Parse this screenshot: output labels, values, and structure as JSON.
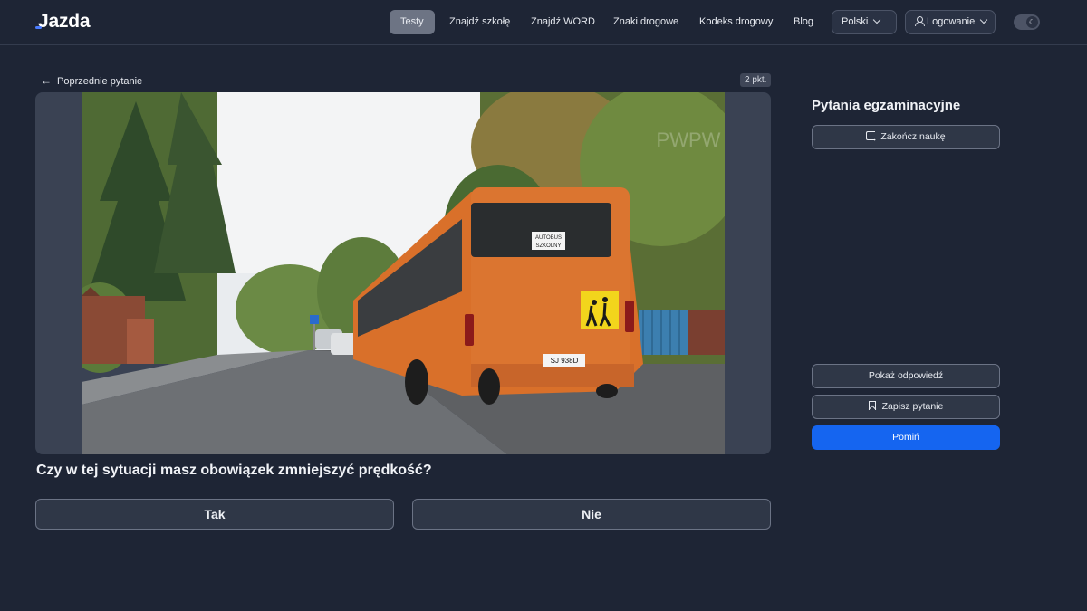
{
  "header": {
    "logo": "Jazda",
    "nav": [
      {
        "label": "Testy",
        "active": true
      },
      {
        "label": "Znajdź szkołę"
      },
      {
        "label": "Znajdź WORD"
      },
      {
        "label": "Znaki drogowe"
      },
      {
        "label": "Kodeks drogowy"
      },
      {
        "label": "Blog"
      }
    ],
    "language": "Polski",
    "login": "Logowanie",
    "theme_toggle_icon": "moon-icon"
  },
  "question_panel": {
    "back_label": "Poprzednie pytanie",
    "points": "2 pkt.",
    "question": "Czy w tej sytuacji masz obowiązek zmniejszyć prędkość?",
    "answers": [
      "Tak",
      "Nie"
    ],
    "photo": {
      "bus_sign": [
        "AUTOBUS",
        "SZKOLNY"
      ],
      "plate": "SJ 938D",
      "watermark": "PWPW"
    }
  },
  "sidebar": {
    "title": "Pytania egzaminacyjne",
    "finish_label": "Zakończ naukę",
    "show_answer_label": "Pokaż odpowiedź",
    "save_label": "Zapisz pytanie",
    "skip_label": "Pomiń"
  },
  "colors": {
    "background": "#1e2535",
    "primary": "#1565f0",
    "bus": "#d9702a",
    "sign": "#f2d51c"
  }
}
